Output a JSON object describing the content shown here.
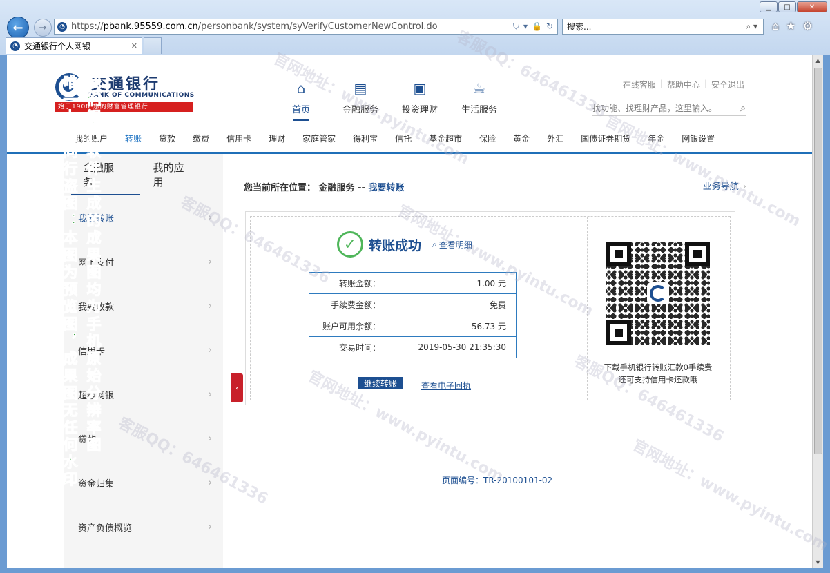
{
  "browser": {
    "url_prefix": "https://",
    "url_host": "pbank.95559.com.cn",
    "url_path": "/personbank/system/syVerifyCustomerNewControl.do",
    "search_placeholder": "搜索...",
    "tab_title": "交通银行个人网银",
    "window_min": "▁",
    "window_max": "□",
    "window_close": "✕"
  },
  "header": {
    "logo_cn": "交通银行",
    "logo_en": "BANK OF COMMUNICATIONS",
    "logo_slogan": "始于1908 您的财富管理银行",
    "topnav": [
      {
        "label": "首页",
        "icon": "home-icon"
      },
      {
        "label": "金融服务",
        "icon": "finance-icon"
      },
      {
        "label": "投资理财",
        "icon": "briefcase-icon"
      },
      {
        "label": "生活服务",
        "icon": "coffee-icon"
      }
    ],
    "toplinks": [
      "在线客服",
      "帮助中心",
      "安全退出"
    ],
    "search_placeholder": "找功能、找理财产品，这里输入。",
    "subnav": [
      "我的账户",
      "转账",
      "贷款",
      "缴费",
      "信用卡",
      "理财",
      "家庭管家",
      "得利宝",
      "信托",
      "基金超市",
      "保险",
      "黄金",
      "外汇",
      "国债证券期货",
      "年金",
      "网银设置"
    ]
  },
  "left": {
    "tabs": [
      "金融服务",
      "我的应用"
    ],
    "menu": [
      "我要转账",
      "网上支付",
      "我要收款",
      "信用卡",
      "超级网银",
      "贷款",
      "资金归集",
      "资产负债概览"
    ]
  },
  "main": {
    "breadcrumb_label": "您当前所在位置：",
    "breadcrumb_parent": "金融服务",
    "breadcrumb_sep": "--",
    "breadcrumb_current": "我要转账",
    "biz_guide": "业务导航",
    "success_text": "转账成功",
    "detail_link": "查看明细",
    "rows": [
      {
        "k": "转账金额：",
        "v": "1.00 元"
      },
      {
        "k": "手续费金额：",
        "v": "免费"
      },
      {
        "k": "账户可用余额：",
        "v": "56.73 元"
      },
      {
        "k": "交易时间：",
        "v": "2019-05-30 21:35:30"
      }
    ],
    "continue_btn": "继续转账",
    "receipt_link": "查看电子回执",
    "qr_caption_1": "下载手机银行转账汇款0手续费",
    "qr_caption_2": "还可支持信用卡还款哦",
    "page_no": "页面编号：TR-20100101-02"
  },
  "watermark": {
    "vertical_a": "唯一上门同行盗图：本图为预览图，成果图无任何水印",
    "vertical_b": "我们银行软件生成的成果图均为手机原始分辨率图",
    "diag": [
      "官网地址：www.pyintu.com",
      "客服QQ：646461336"
    ]
  }
}
